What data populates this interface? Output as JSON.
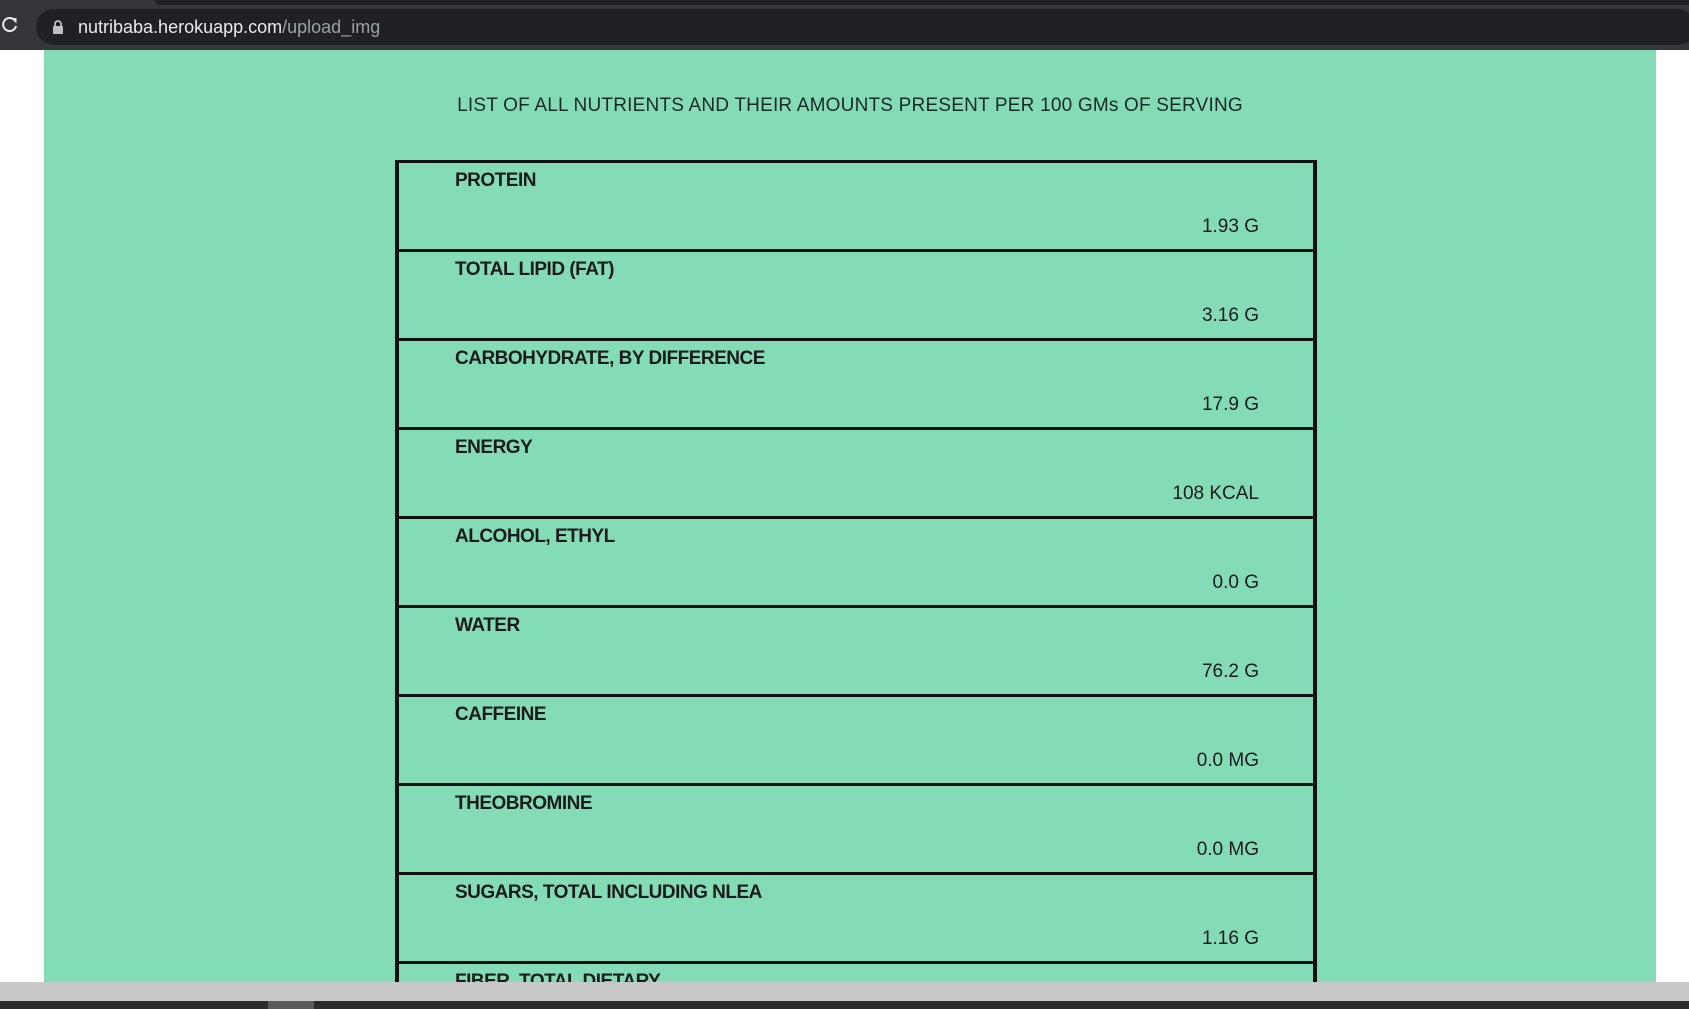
{
  "browser": {
    "url_domain": "nutribaba.herokuapp.com",
    "url_path": "/upload_img"
  },
  "page": {
    "heading": "LIST OF ALL NUTRIENTS AND THEIR AMOUNTS PRESENT PER 100 GMs OF SERVING",
    "nutrients": [
      {
        "name": "PROTEIN",
        "value": "1.93 G"
      },
      {
        "name": "TOTAL LIPID (FAT)",
        "value": "3.16 G"
      },
      {
        "name": "CARBOHYDRATE, BY DIFFERENCE",
        "value": "17.9 G"
      },
      {
        "name": "ENERGY",
        "value": "108 KCAL"
      },
      {
        "name": "ALCOHOL, ETHYL",
        "value": "0.0 G"
      },
      {
        "name": "WATER",
        "value": "76.2 G"
      },
      {
        "name": "CAFFEINE",
        "value": "0.0 MG"
      },
      {
        "name": "THEOBROMINE",
        "value": "0.0 MG"
      },
      {
        "name": "SUGARS, TOTAL INCLUDING NLEA",
        "value": "1.16 G"
      },
      {
        "name": "FIBER, TOTAL DIETARY",
        "value": ""
      }
    ]
  },
  "colors": {
    "page_background": "#84dcb7",
    "browser_chrome": "#35363a"
  }
}
